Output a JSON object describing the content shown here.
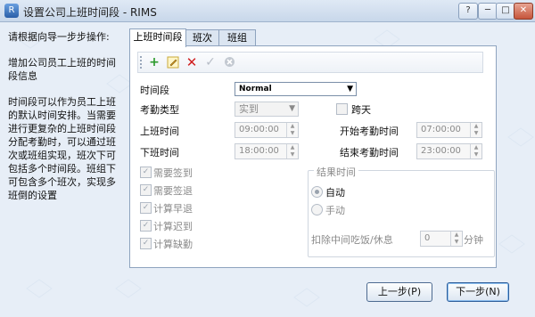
{
  "window": {
    "title": "设置公司上班时间段 - RIMS",
    "controls": {
      "help": "?",
      "minimize": "─",
      "maximize": "□",
      "close": "✕"
    }
  },
  "guide": {
    "heading": "请根据向导一步步操作:",
    "p1": "增加公司员工上班的时间段信息",
    "p2": "时间段可以作为员工上班的默认时间安排。当需要进行更复杂的上班时间段分配考勤时，可以通过班次或班组实现，班次下可包括多个时间段。班组下可包含多个班次，实现多班倒的设置"
  },
  "tabs": [
    {
      "label": "上班时间段"
    },
    {
      "label": "班次"
    },
    {
      "label": "班组"
    }
  ],
  "toolbar": {
    "add_icon": "plus-icon",
    "edit_icon": "pencil-icon",
    "delete_icon": "x-icon",
    "confirm_icon": "check-icon",
    "cancel_icon": "circle-x-icon"
  },
  "form": {
    "timeslot_label": "时间段",
    "timeslot_value": "Normal",
    "attendance_type_label": "考勤类型",
    "attendance_type_value": "实到",
    "cross_day_label": "跨天",
    "start_time_label": "上班时间",
    "start_time_value": "09:00:00",
    "end_time_label": "下班时间",
    "end_time_value": "18:00:00",
    "start_check_label": "开始考勤时间",
    "start_check_value": "07:00:00",
    "end_check_label": "结束考勤时间",
    "end_check_value": "23:00:00",
    "checkboxes": [
      {
        "label": "需要签到",
        "checked": true
      },
      {
        "label": "需要签退",
        "checked": true
      },
      {
        "label": "计算早退",
        "checked": true
      },
      {
        "label": "计算迟到",
        "checked": true
      },
      {
        "label": "计算缺勤",
        "checked": true
      }
    ]
  },
  "result": {
    "title": "结果时间",
    "auto_label": "自动",
    "manual_label": "手动",
    "deduct_label": "扣除中间吃饭/休息",
    "deduct_value": "0",
    "unit": "分钟"
  },
  "buttons": {
    "prev": "上一步(P)",
    "next": "下一步(N)"
  },
  "colors": {
    "window_bg": "#e7eef7",
    "add_green": "#2c9a2c",
    "delete_red": "#d02020",
    "accent_blue": "#2d5d9a"
  }
}
